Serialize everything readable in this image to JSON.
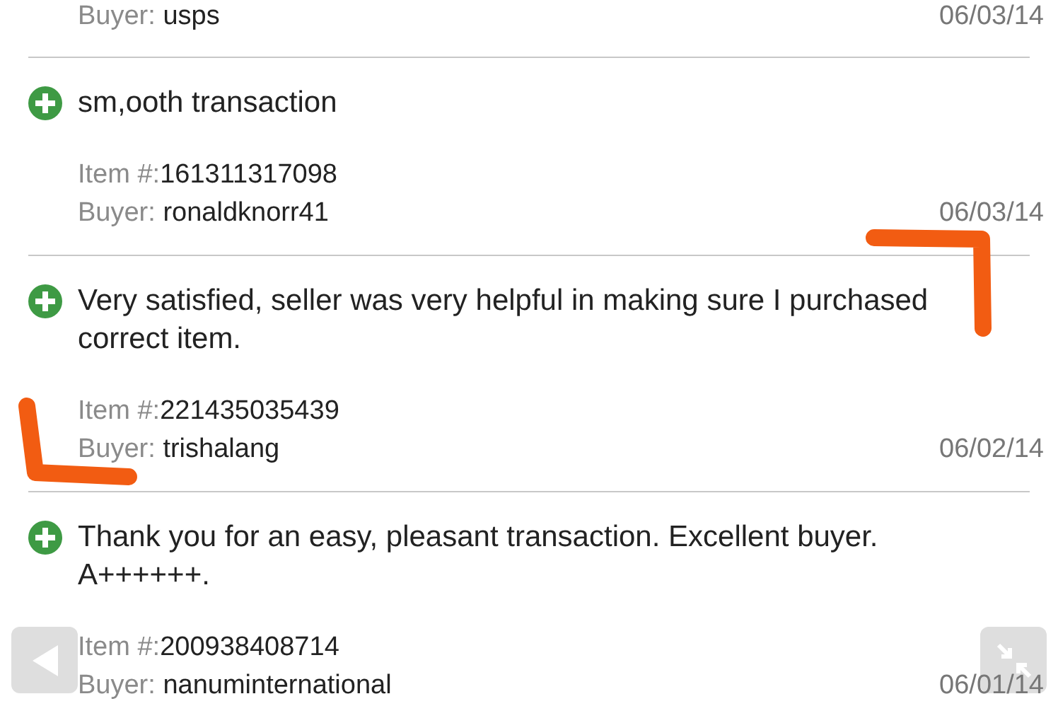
{
  "entries": [
    {
      "buyer_label": "Buyer:",
      "buyer": "usps",
      "date": "06/03/14"
    },
    {
      "kind": "positive",
      "comment": "sm,ooth transaction",
      "item_label": "Item #:",
      "item": "161311317098",
      "buyer_label": "Buyer:",
      "buyer": "ronaldknorr41",
      "date": "06/03/14"
    },
    {
      "kind": "positive",
      "comment": "Very satisfied, seller was very helpful in making sure I purchased correct item.",
      "item_label": "Item #:",
      "item": "221435035439",
      "buyer_label": "Buyer:",
      "buyer": "trishalang",
      "date": "06/02/14"
    },
    {
      "kind": "positive",
      "comment": "Thank you for an easy, pleasant transaction. Excellent buyer. A++++++.",
      "item_label": "Item #:",
      "item": "200938408714",
      "buyer_label": "Buyer:",
      "buyer": "nanuminternational",
      "date": "06/01/14"
    }
  ]
}
